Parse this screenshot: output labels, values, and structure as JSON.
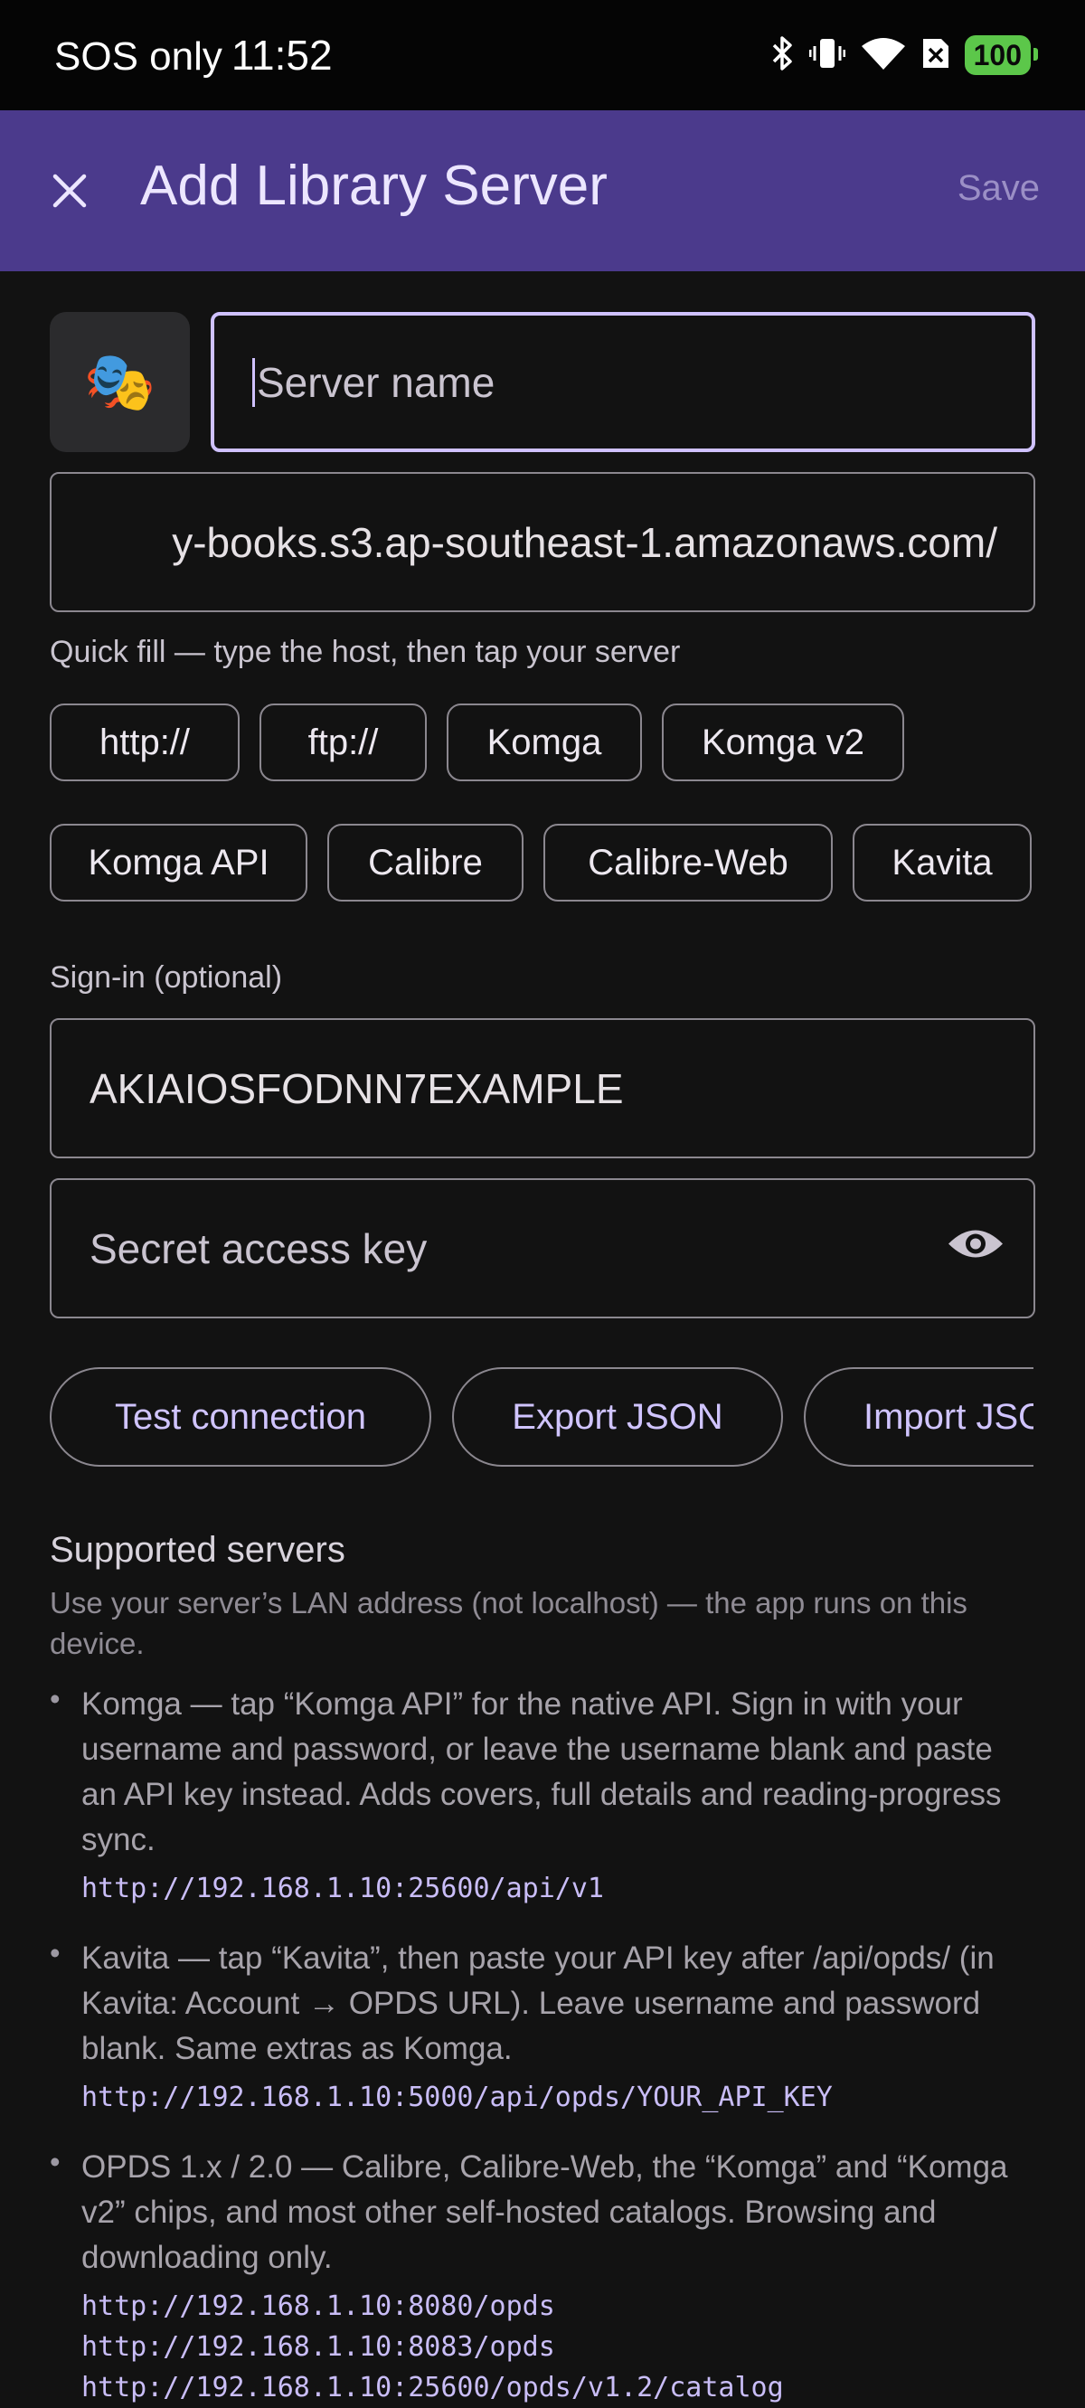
{
  "status_bar": {
    "carrier": "SOS only",
    "time": "11:52",
    "battery": "100"
  },
  "app_bar": {
    "title": "Add Library Server",
    "save_label": "Save"
  },
  "form": {
    "server_icon": "🎭",
    "server_name_placeholder": "Server name",
    "server_name_value": "",
    "url_value": "y-books.s3.ap-southeast-1.amazonaws.com/",
    "quick_fill_helper": "Quick fill — type the host, then tap your server",
    "chips": [
      "http://",
      "ftp://",
      "Komga",
      "Komga v2",
      "Komga API",
      "Calibre",
      "Calibre-Web",
      "Kavita"
    ],
    "signin_label": "Sign-in (optional)",
    "access_key_value": "AKIAIOSFODNN7EXAMPLE",
    "secret_placeholder": "Secret access key",
    "actions": [
      "Test connection",
      "Export JSON",
      "Import JSON"
    ]
  },
  "supported": {
    "title": "Supported servers",
    "description": "Use your server’s LAN address (not localhost) — the app runs on this device.",
    "items": [
      {
        "text": "Komga — tap “Komga API” for the native API. Sign in with your username and password, or leave the username blank and paste an API key instead. Adds covers, full details and reading-progress sync.",
        "urls": [
          "http://192.168.1.10:25600/api/v1"
        ]
      },
      {
        "text": "Kavita — tap “Kavita”, then paste your API key after /api/opds/ (in Kavita: Account → OPDS URL). Leave username and password blank. Same extras as Komga.",
        "urls": [
          "http://192.168.1.10:5000/api/opds/YOUR_API_KEY"
        ]
      },
      {
        "text": "OPDS 1.x / 2.0 — Calibre, Calibre-Web, the “Komga” and “Komga v2” chips, and most other self-hosted catalogs. Browsing and downloading only.",
        "urls": [
          "http://192.168.1.10:8080/opds",
          "http://192.168.1.10:8083/opds",
          "http://192.168.1.10:25600/opds/v1.2/catalog"
        ]
      }
    ]
  },
  "icons": {
    "close": "close-icon",
    "visibility": "eye-icon",
    "bluetooth": "bluetooth-icon",
    "vibrate": "vibrate-icon",
    "wifi": "wifi-icon",
    "no_sim": "no-sim-icon"
  },
  "colors": {
    "app_bar": "#4b3a8c",
    "accent": "#cfc1ff",
    "battery": "#5cc74a"
  }
}
